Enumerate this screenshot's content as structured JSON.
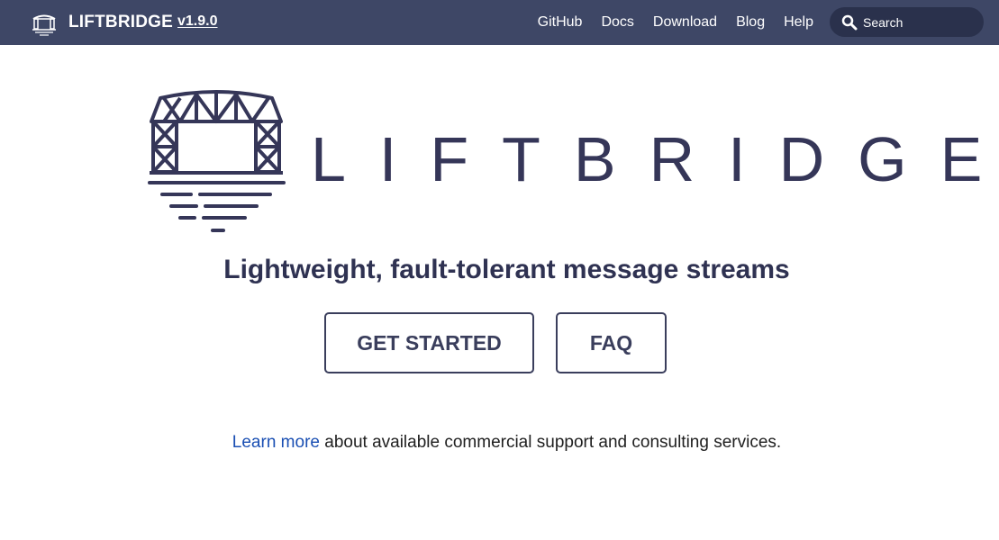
{
  "navbar": {
    "brand_title": "LIFTBRIDGE",
    "version": "v1.9.0",
    "links": [
      {
        "label": "GitHub"
      },
      {
        "label": "Docs"
      },
      {
        "label": "Download"
      },
      {
        "label": "Blog"
      },
      {
        "label": "Help"
      }
    ],
    "search": {
      "placeholder": "Search",
      "icon": "search-icon"
    }
  },
  "hero": {
    "logo_icon": "lift-bridge-icon",
    "wordmark": "LIFTBRIDGE",
    "tagline": "Lightweight, fault-tolerant message streams",
    "buttons": {
      "get_started": "GET STARTED",
      "faq": "FAQ"
    }
  },
  "support": {
    "link_text": "Learn more",
    "text": " about available commercial support and consulting services."
  },
  "colors": {
    "navbar_bg": "#3e4766",
    "search_bg": "#2a314c",
    "brand_dark": "#353658",
    "link_blue": "#1a4fb3"
  }
}
